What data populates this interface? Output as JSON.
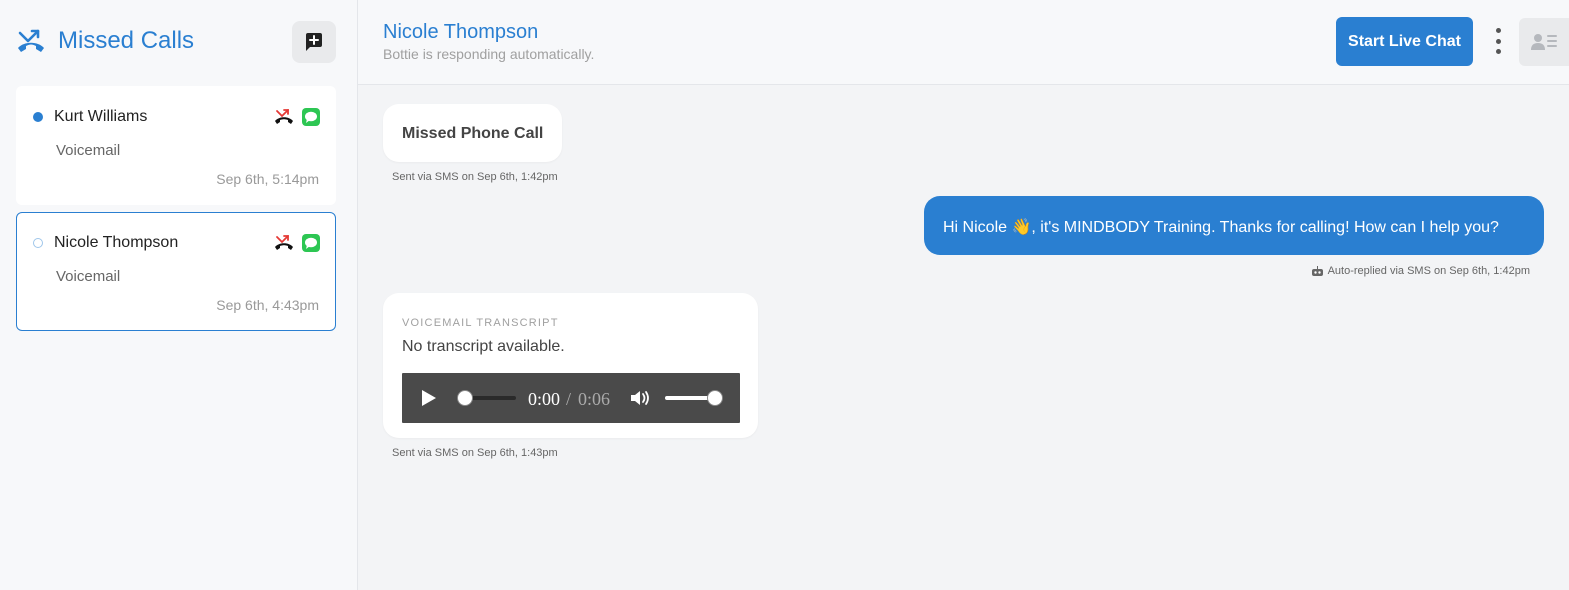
{
  "sidebar": {
    "title": "Missed Calls",
    "title_icon": "missed-call-icon",
    "new_message_icon": "new-message-icon",
    "conversations": [
      {
        "name": "Kurt Williams",
        "preview": "Voicemail",
        "time": "Sep 6th, 5:14pm",
        "unread": true,
        "selected": false
      },
      {
        "name": "Nicole Thompson",
        "preview": "Voicemail",
        "time": "Sep 6th, 4:43pm",
        "unread": false,
        "selected": true
      }
    ]
  },
  "header": {
    "contact_name": "Nicole Thompson",
    "status": "Bottie is responding automatically.",
    "live_chat_label": "Start Live Chat",
    "more_icon": "vertical-ellipsis-icon",
    "profile_icon": "contact-card-icon"
  },
  "messages": {
    "missed": {
      "text": "Missed Phone Call",
      "meta": "Sent via SMS on Sep 6th, 1:42pm"
    },
    "auto_reply": {
      "text": "Hi Nicole 👋, it's MINDBODY Training. Thanks for calling! How can I help you?",
      "meta": "Auto-replied via SMS on Sep 6th, 1:42pm",
      "meta_icon": "robot-icon"
    },
    "voicemail": {
      "label": "VOICEMAIL TRANSCRIPT",
      "text": "No transcript available.",
      "player": {
        "current": "0:00",
        "separator": "/",
        "duration": "0:06",
        "progress": 0,
        "volume": 1
      },
      "meta": "Sent via SMS on Sep 6th, 1:43pm"
    }
  },
  "colors": {
    "accent": "#2a7fd1",
    "sms_green": "#2dc653"
  }
}
